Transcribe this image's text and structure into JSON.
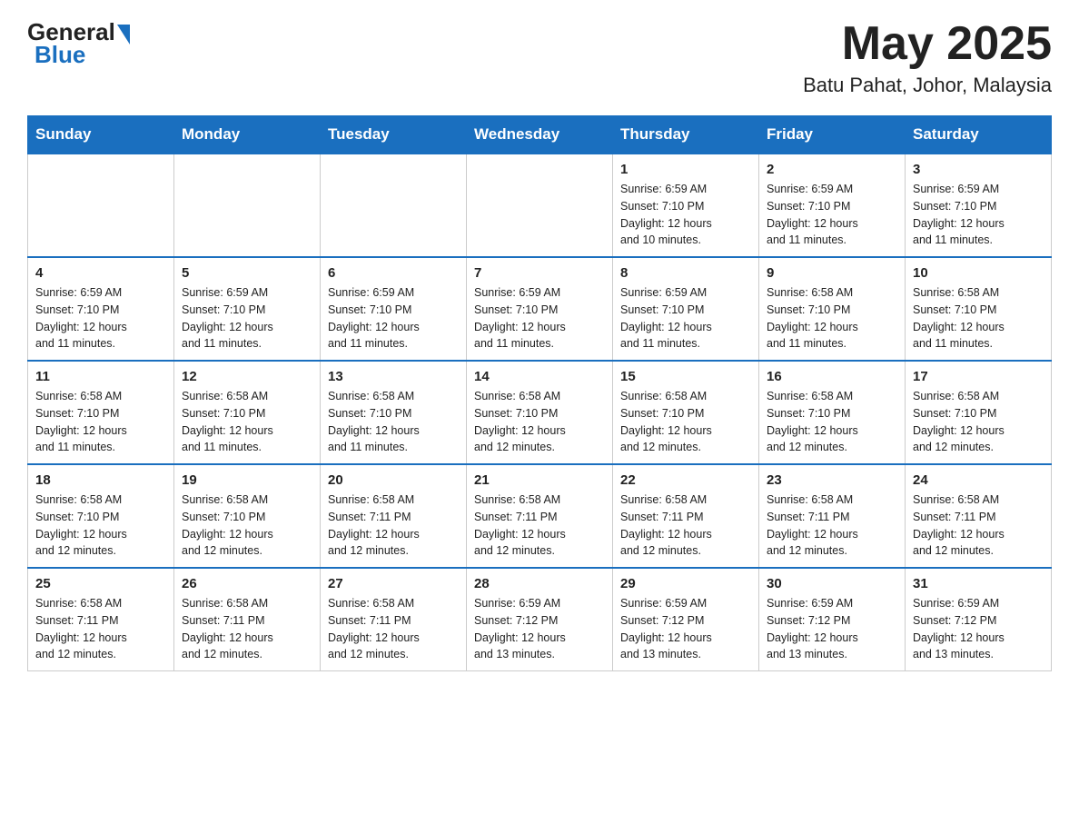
{
  "header": {
    "logo_general": "General",
    "logo_blue": "Blue",
    "month_year": "May 2025",
    "location": "Batu Pahat, Johor, Malaysia"
  },
  "days_of_week": [
    "Sunday",
    "Monday",
    "Tuesday",
    "Wednesday",
    "Thursday",
    "Friday",
    "Saturday"
  ],
  "weeks": [
    [
      {
        "day": "",
        "info": ""
      },
      {
        "day": "",
        "info": ""
      },
      {
        "day": "",
        "info": ""
      },
      {
        "day": "",
        "info": ""
      },
      {
        "day": "1",
        "info": "Sunrise: 6:59 AM\nSunset: 7:10 PM\nDaylight: 12 hours\nand 10 minutes."
      },
      {
        "day": "2",
        "info": "Sunrise: 6:59 AM\nSunset: 7:10 PM\nDaylight: 12 hours\nand 11 minutes."
      },
      {
        "day": "3",
        "info": "Sunrise: 6:59 AM\nSunset: 7:10 PM\nDaylight: 12 hours\nand 11 minutes."
      }
    ],
    [
      {
        "day": "4",
        "info": "Sunrise: 6:59 AM\nSunset: 7:10 PM\nDaylight: 12 hours\nand 11 minutes."
      },
      {
        "day": "5",
        "info": "Sunrise: 6:59 AM\nSunset: 7:10 PM\nDaylight: 12 hours\nand 11 minutes."
      },
      {
        "day": "6",
        "info": "Sunrise: 6:59 AM\nSunset: 7:10 PM\nDaylight: 12 hours\nand 11 minutes."
      },
      {
        "day": "7",
        "info": "Sunrise: 6:59 AM\nSunset: 7:10 PM\nDaylight: 12 hours\nand 11 minutes."
      },
      {
        "day": "8",
        "info": "Sunrise: 6:59 AM\nSunset: 7:10 PM\nDaylight: 12 hours\nand 11 minutes."
      },
      {
        "day": "9",
        "info": "Sunrise: 6:58 AM\nSunset: 7:10 PM\nDaylight: 12 hours\nand 11 minutes."
      },
      {
        "day": "10",
        "info": "Sunrise: 6:58 AM\nSunset: 7:10 PM\nDaylight: 12 hours\nand 11 minutes."
      }
    ],
    [
      {
        "day": "11",
        "info": "Sunrise: 6:58 AM\nSunset: 7:10 PM\nDaylight: 12 hours\nand 11 minutes."
      },
      {
        "day": "12",
        "info": "Sunrise: 6:58 AM\nSunset: 7:10 PM\nDaylight: 12 hours\nand 11 minutes."
      },
      {
        "day": "13",
        "info": "Sunrise: 6:58 AM\nSunset: 7:10 PM\nDaylight: 12 hours\nand 11 minutes."
      },
      {
        "day": "14",
        "info": "Sunrise: 6:58 AM\nSunset: 7:10 PM\nDaylight: 12 hours\nand 12 minutes."
      },
      {
        "day": "15",
        "info": "Sunrise: 6:58 AM\nSunset: 7:10 PM\nDaylight: 12 hours\nand 12 minutes."
      },
      {
        "day": "16",
        "info": "Sunrise: 6:58 AM\nSunset: 7:10 PM\nDaylight: 12 hours\nand 12 minutes."
      },
      {
        "day": "17",
        "info": "Sunrise: 6:58 AM\nSunset: 7:10 PM\nDaylight: 12 hours\nand 12 minutes."
      }
    ],
    [
      {
        "day": "18",
        "info": "Sunrise: 6:58 AM\nSunset: 7:10 PM\nDaylight: 12 hours\nand 12 minutes."
      },
      {
        "day": "19",
        "info": "Sunrise: 6:58 AM\nSunset: 7:10 PM\nDaylight: 12 hours\nand 12 minutes."
      },
      {
        "day": "20",
        "info": "Sunrise: 6:58 AM\nSunset: 7:11 PM\nDaylight: 12 hours\nand 12 minutes."
      },
      {
        "day": "21",
        "info": "Sunrise: 6:58 AM\nSunset: 7:11 PM\nDaylight: 12 hours\nand 12 minutes."
      },
      {
        "day": "22",
        "info": "Sunrise: 6:58 AM\nSunset: 7:11 PM\nDaylight: 12 hours\nand 12 minutes."
      },
      {
        "day": "23",
        "info": "Sunrise: 6:58 AM\nSunset: 7:11 PM\nDaylight: 12 hours\nand 12 minutes."
      },
      {
        "day": "24",
        "info": "Sunrise: 6:58 AM\nSunset: 7:11 PM\nDaylight: 12 hours\nand 12 minutes."
      }
    ],
    [
      {
        "day": "25",
        "info": "Sunrise: 6:58 AM\nSunset: 7:11 PM\nDaylight: 12 hours\nand 12 minutes."
      },
      {
        "day": "26",
        "info": "Sunrise: 6:58 AM\nSunset: 7:11 PM\nDaylight: 12 hours\nand 12 minutes."
      },
      {
        "day": "27",
        "info": "Sunrise: 6:58 AM\nSunset: 7:11 PM\nDaylight: 12 hours\nand 12 minutes."
      },
      {
        "day": "28",
        "info": "Sunrise: 6:59 AM\nSunset: 7:12 PM\nDaylight: 12 hours\nand 13 minutes."
      },
      {
        "day": "29",
        "info": "Sunrise: 6:59 AM\nSunset: 7:12 PM\nDaylight: 12 hours\nand 13 minutes."
      },
      {
        "day": "30",
        "info": "Sunrise: 6:59 AM\nSunset: 7:12 PM\nDaylight: 12 hours\nand 13 minutes."
      },
      {
        "day": "31",
        "info": "Sunrise: 6:59 AM\nSunset: 7:12 PM\nDaylight: 12 hours\nand 13 minutes."
      }
    ]
  ]
}
